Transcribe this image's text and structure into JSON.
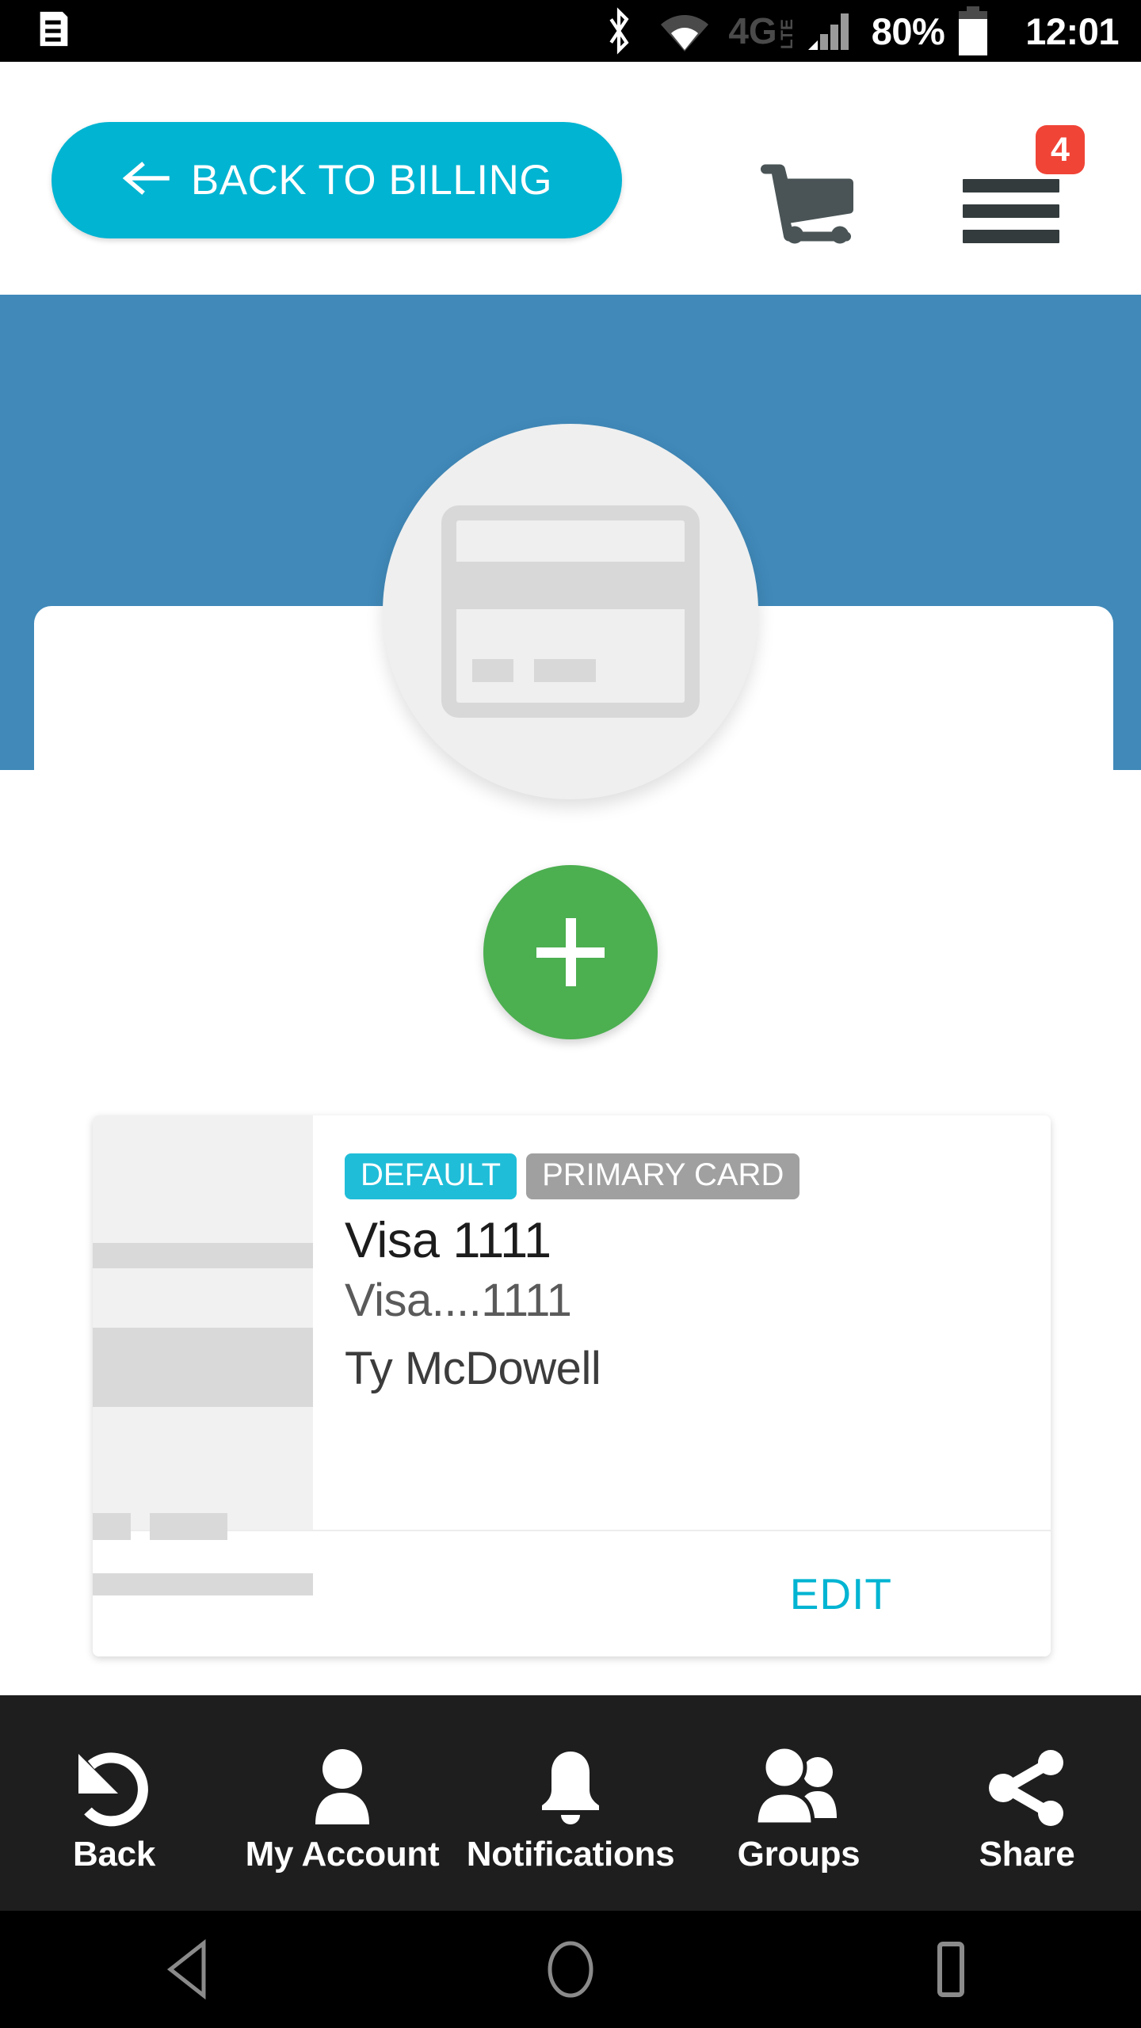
{
  "status_bar": {
    "left_icon": "message-icon",
    "bluetooth_icon": "bluetooth-icon",
    "wifi_icon": "wifi-icon",
    "network_type": "4G",
    "network_sub": "LTE",
    "signal_icon": "signal-bars-icon",
    "battery_percent": "80%",
    "battery_icon": "battery-icon",
    "time": "12:01"
  },
  "header": {
    "back_button_label": "BACK TO BILLING",
    "back_arrow_icon": "arrow-left-icon",
    "cart_icon": "shopping-cart-icon",
    "menu_icon": "hamburger-menu-icon",
    "menu_badge_count": "4",
    "accent_color": "#00B4D2",
    "badge_color": "#F04437"
  },
  "hero": {
    "icon": "credit-card-icon",
    "circle_color": "#EFEFEF",
    "band_color": "#4089B9"
  },
  "add_button": {
    "icon": "plus-icon",
    "color": "#4CAF50"
  },
  "payment_method": {
    "badges": [
      {
        "label": "DEFAULT",
        "color": "#20BDD8"
      },
      {
        "label": "PRIMARY CARD",
        "color": "#A0A0A0"
      }
    ],
    "title": "Visa 1111",
    "masked_number": "Visa....1111",
    "cardholder": "Ty McDowell",
    "edit_label": "EDIT",
    "thumbnail_icon": "card-placeholder-image"
  },
  "bottom_nav": {
    "items": [
      {
        "label": "Back",
        "icon": "undo-arrow-icon"
      },
      {
        "label": "My Account",
        "icon": "person-icon"
      },
      {
        "label": "Notifications",
        "icon": "bell-icon"
      },
      {
        "label": "Groups",
        "icon": "people-group-icon"
      },
      {
        "label": "Share",
        "icon": "share-icon"
      }
    ]
  },
  "system_nav": {
    "back_icon": "triangle-back-icon",
    "home_icon": "circle-home-icon",
    "recents_icon": "square-recents-icon"
  }
}
